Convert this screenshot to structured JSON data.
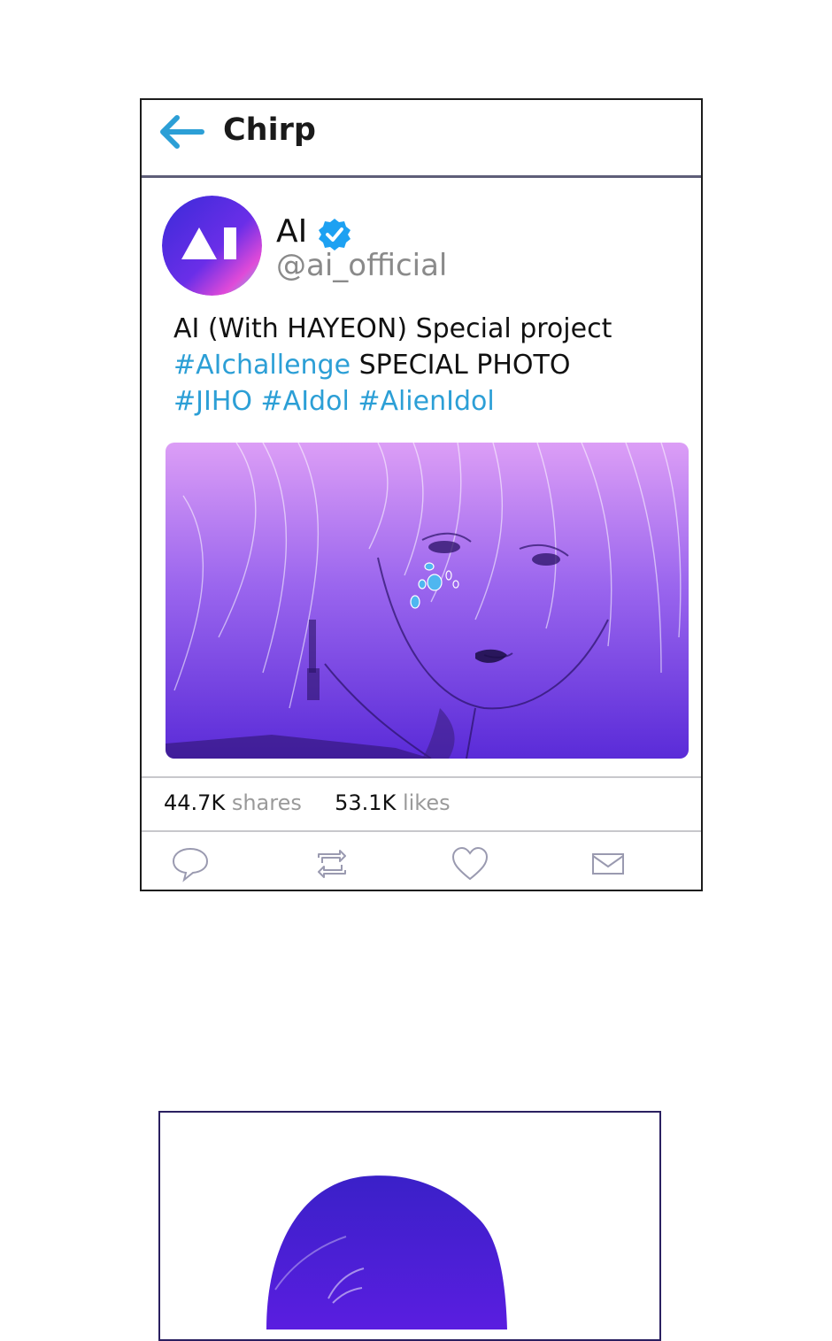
{
  "app": {
    "title": "Chirp"
  },
  "post": {
    "display_name": "AI",
    "handle": "@ai_official",
    "avatar_text": "AI",
    "text_line1": "AI (With HAYEON) Special project",
    "text_line2_tag": "#AIchallenge",
    "text_line2_rest": " SPECIAL PHOTO",
    "text_line3_tags": "#JIHO #AIdol #AlienIdol",
    "image_alt": "illustration of a character with blue tear-like gems under the eye"
  },
  "stats": {
    "shares_count": "44.7K",
    "shares_label": "shares",
    "likes_count": "53.1K",
    "likes_label": "likes"
  },
  "actions": [
    {
      "name": "reply",
      "icon": "speech-bubble-icon"
    },
    {
      "name": "repost",
      "icon": "repost-icon"
    },
    {
      "name": "like",
      "icon": "heart-icon"
    },
    {
      "name": "message",
      "icon": "envelope-icon"
    }
  ],
  "colors": {
    "accent": "#2c9fd6",
    "verified": "#1da1f2",
    "image_top": "#d79af5",
    "image_bottom": "#5a2ad8"
  }
}
